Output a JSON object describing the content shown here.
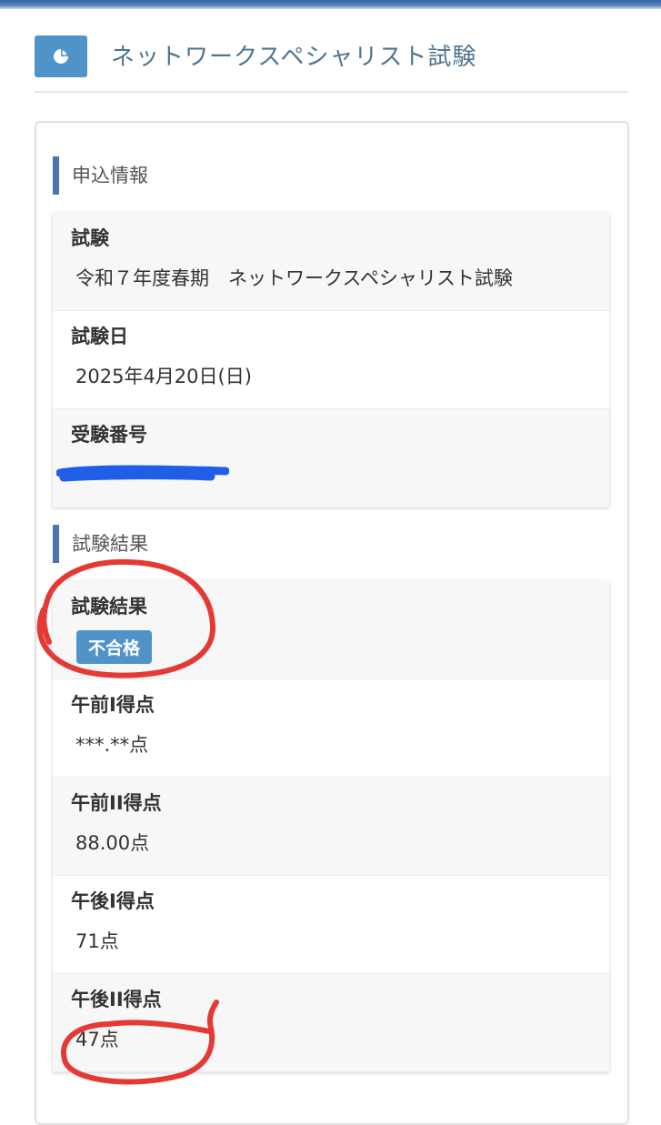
{
  "header": {
    "icon": "pie-chart-icon",
    "title": "ネットワークスペシャリスト試験"
  },
  "application_info": {
    "heading": "申込情報",
    "exam_label": "試験",
    "exam_value": "令和７年度春期　ネットワークスペシャリスト試験",
    "date_label": "試験日",
    "date_value": "2025年4月20日(日)",
    "number_label": "受験番号"
  },
  "results": {
    "heading": "試験結果",
    "result_label": "試験結果",
    "result_badge": "不合格",
    "am1_label": "午前I得点",
    "am1_value": "***.**点",
    "am2_label": "午前II得点",
    "am2_value": "88.00点",
    "pm1_label": "午後I得点",
    "pm1_value": "71点",
    "pm2_label": "午後II得点",
    "pm2_value": "47点"
  },
  "colors": {
    "accent": "#4f93c9",
    "heading_bar": "#4a76b0",
    "redaction": "#1f5fe6",
    "annotation": "#e53935"
  }
}
